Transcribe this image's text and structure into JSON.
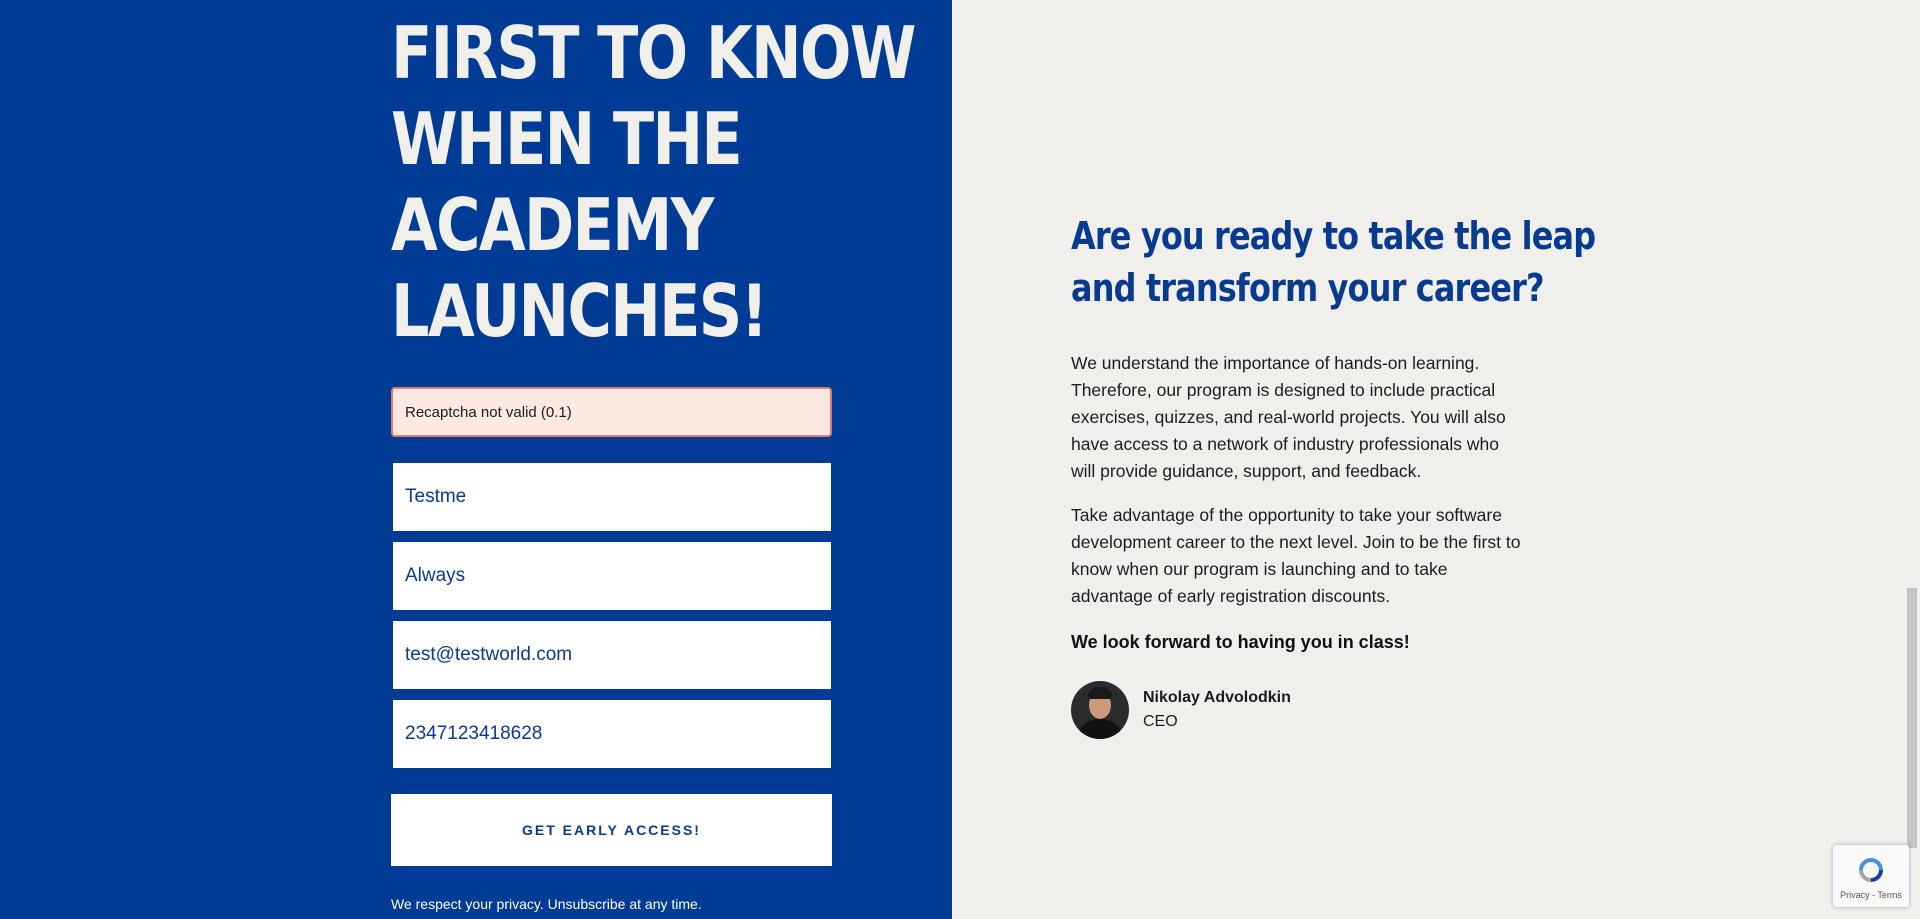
{
  "headline": {
    "lines": [
      "FIRST TO KNOW",
      "WHEN THE",
      "ACADEMY",
      "LAUNCHES!"
    ]
  },
  "form": {
    "error_message": "Recaptcha not valid (0.1)",
    "first_name_value": "Testme",
    "last_name_value": "Always",
    "email_value": "test@testworld.com",
    "phone_value": "2347123418628",
    "submit_label": "GET EARLY ACCESS!",
    "privacy_text": "We respect your privacy. Unsubscribe at any time."
  },
  "info": {
    "title_line_1": "Are you ready to take the leap",
    "title_line_2": "and transform your career?",
    "paragraph_1": "We understand the importance of hands-on learning. Therefore, our program is designed to include practical exercises, quizzes, and real-world projects. You will also have access to a network of industry professionals who will provide guidance, support, and feedback.",
    "paragraph_2": "Take advantage of the opportunity to take your software development career to the next level. Join to be the first to know when our program is launching and to take advantage of early registration discounts.",
    "closing": "We look forward to having you in class!",
    "author_name": "Nikolay Advolodkin",
    "author_role": "CEO"
  },
  "recaptcha": {
    "terms_text": "Privacy - Terms"
  },
  "colors": {
    "left_background": "#003b95",
    "right_background": "#f0efeb",
    "accent": "#073b90",
    "error_background": "#fde8e2",
    "error_border": "#e07a6a"
  },
  "icons": {
    "recaptcha": "recaptcha-icon",
    "avatar": "author-avatar"
  }
}
